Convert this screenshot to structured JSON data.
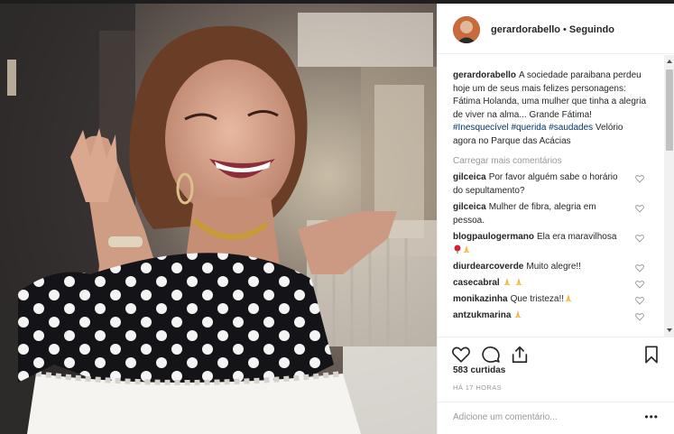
{
  "post": {
    "username": "gerardorabello",
    "separator": "•",
    "follow_status": "Seguindo",
    "caption_text": "A sociedade paraibana perdeu hoje um de seus mais felizes personagens: Fátima Holanda, uma mulher que tinha a alegria de viver na alma... Grande Fátima!",
    "hashtags": [
      "#Inesquecível",
      "#querida",
      "#saudades"
    ],
    "caption_tail": "Velório agora no Parque das Acácias",
    "load_more": "Carregar mais comentários",
    "likes": "583 curtidas",
    "time": "HÁ 17 HORAS",
    "add_comment_placeholder": "Adicione um comentário...",
    "more_options": "•••"
  },
  "comments": [
    {
      "user": "gilceica",
      "text": "Por favor alguém sabe o horário do sepultamento?"
    },
    {
      "user": "gilceica",
      "text": "Mulher de fibra, alegria em pessoa."
    },
    {
      "user": "blogpaulogermano",
      "text": "Ela era maravilhosa",
      "emoji": [
        "rose",
        "praying-hands"
      ]
    },
    {
      "user": "diurdearcoverde",
      "text": "Muito alegre!!"
    },
    {
      "user": "casecabral",
      "text": "",
      "emoji": [
        "praying-hands",
        "praying-hands"
      ]
    },
    {
      "user": "monikazinha",
      "text": "Que tristeza!!",
      "emoji": [
        "praying-hands"
      ]
    },
    {
      "user": "antzukmarina",
      "text": "",
      "emoji": [
        "praying-hands"
      ]
    }
  ],
  "icons": {
    "like": "heart-outline-icon",
    "comment": "speech-bubble-icon",
    "share": "share-arrow-icon",
    "save": "bookmark-icon",
    "comment_like": "small-heart-icon"
  },
  "colors": {
    "text": "#262626",
    "muted": "#999999",
    "hashtag": "#003569",
    "border": "#efefef"
  }
}
